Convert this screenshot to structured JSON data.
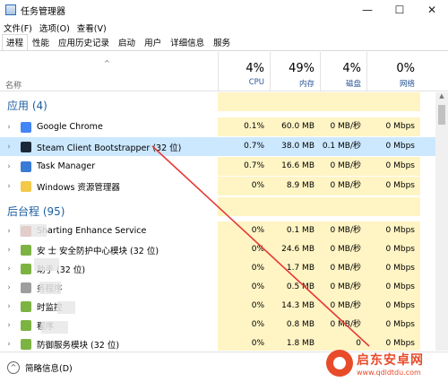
{
  "window": {
    "title": "任务管理器"
  },
  "window_controls": {
    "minimize": "—",
    "maximize": "☐",
    "close": "✕"
  },
  "menu": [
    "文件(F)",
    "选项(O)",
    "查看(V)"
  ],
  "tabs": [
    "进程",
    "性能",
    "应用历史记录",
    "启动",
    "用户",
    "详细信息",
    "服务"
  ],
  "header": {
    "name_label": "名称",
    "sort_arrow": "^",
    "columns": [
      {
        "pct": "4%",
        "label": "CPU"
      },
      {
        "pct": "49%",
        "label": "内存"
      },
      {
        "pct": "4%",
        "label": "磁盘"
      },
      {
        "pct": "0%",
        "label": "网络"
      }
    ]
  },
  "groups": {
    "apps_title": "应用 (4)",
    "background_title_part1": "后台",
    "background_title_part2": "程 (95)"
  },
  "apps": [
    {
      "name": "Google Chrome",
      "cpu": "0.1%",
      "mem": "60.0 MB",
      "disk": "0 MB/秒",
      "net": "0 Mbps",
      "icon_color": "#4285f4",
      "selected": false
    },
    {
      "name": "Steam Client Bootstrapper (32 位)",
      "cpu": "0.7%",
      "mem": "38.0 MB",
      "disk": "0.1 MB/秒",
      "net": "0 Mbps",
      "icon_color": "#1b2838",
      "selected": true
    },
    {
      "name": "Task Manager",
      "cpu": "0.7%",
      "mem": "16.6 MB",
      "disk": "0 MB/秒",
      "net": "0 Mbps",
      "icon_color": "#3a7bd5",
      "selected": false
    },
    {
      "name": "Windows 资源管理器",
      "cpu": "0%",
      "mem": "8.9 MB",
      "disk": "0 MB/秒",
      "net": "0 Mbps",
      "icon_color": "#f3c94a",
      "selected": false
    }
  ],
  "background": [
    {
      "name": "Sharting Enhance Service",
      "cpu": "0%",
      "mem": "0.1 MB",
      "disk": "0 MB/秒",
      "net": "0 Mbps",
      "icon_color": "#c0392b"
    },
    {
      "name": "安 士 安全防护中心模块 (32 位)",
      "cpu": "0%",
      "mem": "24.6 MB",
      "disk": "0 MB/秒",
      "net": "0 Mbps",
      "icon_color": "#7cb342"
    },
    {
      "name": "助手 (32 位)",
      "cpu": "0%",
      "mem": "1.7 MB",
      "disk": "0 MB/秒",
      "net": "0 Mbps",
      "icon_color": "#7cb342"
    },
    {
      "name": "务程序",
      "cpu": "0%",
      "mem": "0.5 MB",
      "disk": "0 MB/秒",
      "net": "0 Mbps",
      "icon_color": "#9e9e9e"
    },
    {
      "name": "时监控",
      "cpu": "0%",
      "mem": "14.3 MB",
      "disk": "0 MB/秒",
      "net": "0 Mbps",
      "icon_color": "#7cb342"
    },
    {
      "name": "程序",
      "cpu": "0%",
      "mem": "0.8 MB",
      "disk": "0 MB/秒",
      "net": "0 Mbps",
      "icon_color": "#7cb342"
    },
    {
      "name": "防御服务模块 (32 位)",
      "cpu": "0%",
      "mem": "1.8 MB",
      "disk": "0",
      "net": "0 Mbps",
      "icon_color": "#7cb342"
    }
  ],
  "footer": {
    "label": "简略信息(D)"
  },
  "watermark": {
    "cn": "启东安卓网",
    "url": "www.qdldtdu.com"
  },
  "colors": {
    "accent": "#1d5fa0",
    "highlight": "#fff4c4",
    "selected": "#cce8ff",
    "arrow": "#e53935"
  }
}
